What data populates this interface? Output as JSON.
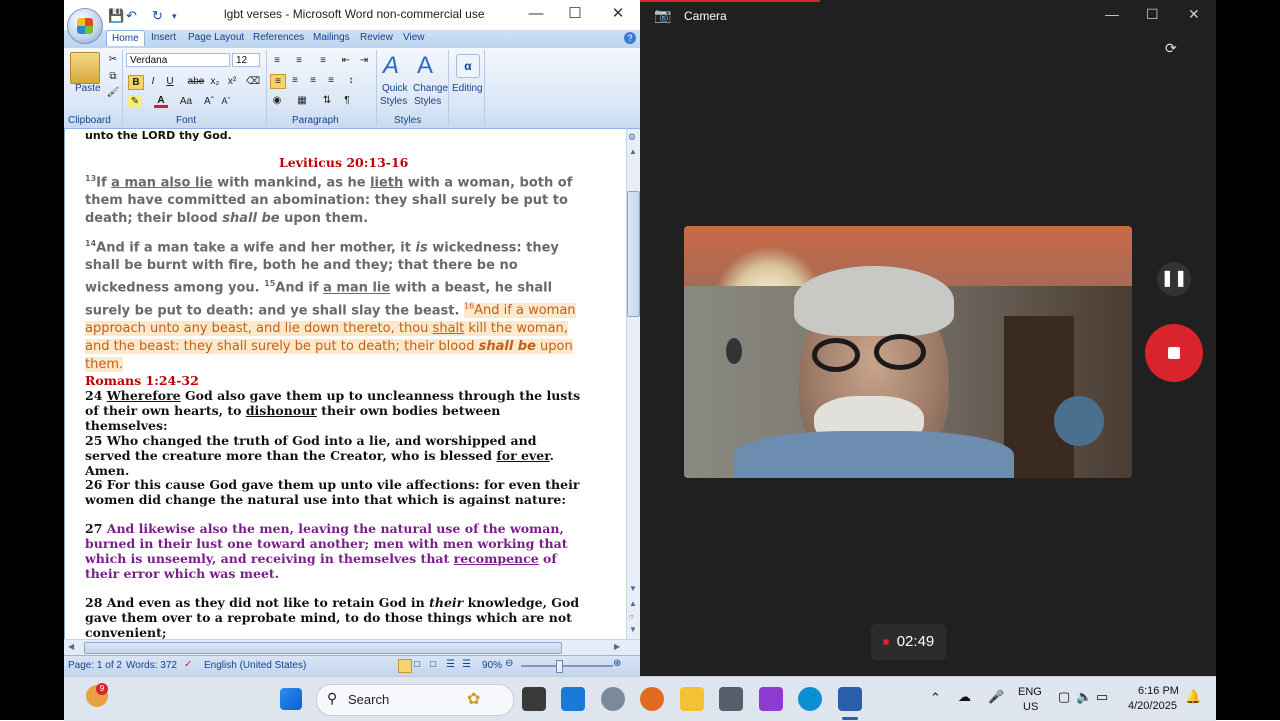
{
  "word": {
    "title": "lgbt verses - Microsoft Word non-commercial use",
    "tabs": [
      "Home",
      "Insert",
      "Page Layout",
      "References",
      "Mailings",
      "Review",
      "View"
    ],
    "ribbon": {
      "paste_label": "Paste",
      "font_name": "Verdana",
      "font_size": "12",
      "quick_styles_1": "Quick",
      "quick_styles_2": "Styles",
      "change_styles_1": "Change",
      "change_styles_2": "Styles",
      "editing_label": "Editing",
      "groups": [
        "Clipboard",
        "Font",
        "Paragraph",
        "Styles"
      ]
    },
    "document": {
      "top_line": "unto the LORD thy God.",
      "ref1": "Leviticus 20:13-16",
      "v13_num": "13",
      "v13_a": "If ",
      "v13_u1": "a man also lie",
      "v13_b": " with mankind, as he ",
      "v13_u2": "lieth",
      "v13_c": " with a woman, both of them have committed an abomination: they shall surely be put to death; their blood ",
      "v13_it": "shall be",
      "v13_d": " upon them.",
      "v14_num": "14",
      "v14_a": "And if a man take a wife and her mother, it ",
      "v14_it": "is",
      "v14_b": " wickedness: they shall be burnt with fire, both he and they; that there be no wickedness among you. ",
      "v15_num": "15",
      "v15_a": "And if ",
      "v15_u": "a man lie",
      "v15_b": " with a beast, he shall surely be put to death: and ye shall slay the beast. ",
      "v16_num": "16",
      "v16_a": "And if a woman approach unto any beast, and lie down thereto, thou ",
      "v16_u": "shalt",
      "v16_b": " kill the woman, and the beast: they shall surely be put to death; their blood ",
      "v16_it": "shall be",
      "v16_c": " upon them.",
      "ref2": "Romans 1:24-32",
      "r24_a": "24 ",
      "r24_u1": "Wherefore",
      "r24_b": " God also gave them up to uncleanness through the lusts of their own hearts, to ",
      "r24_u2": "dishonour",
      "r24_c": " their own bodies between themselves:",
      "r25_a": "25 Who changed the truth of God into a lie, and worshipped and served the creature more than the Creator, who is blessed ",
      "r25_u": "for ever",
      "r25_b": ". Amen.",
      "r26": "26 For this cause God gave them up unto vile affections: for even their women did change the natural use into that which is against nature:",
      "r27_num": "27 ",
      "r27_a": "And likewise also the men, leaving the natural use of the woman, burned in their lust one toward another; men with men working that which is unseemly, and receiving in themselves that ",
      "r27_u": "recompence",
      "r27_b": " of their error which was meet.",
      "r28_a": "28 And even as they did not like to retain God in ",
      "r28_it": "their",
      "r28_b": " knowledge, God gave them over to a reprobate mind, to do those things which are not convenient;"
    },
    "status": {
      "page": "Page: 1 of 2",
      "words": "Words: 372",
      "language": "English (United States)",
      "zoom": "90%"
    }
  },
  "camera": {
    "title": "Camera",
    "timer": "02:49",
    "pause_icon": "pause-icon",
    "stop_icon": "stop-icon"
  },
  "taskbar": {
    "badge": "9",
    "search_label": "Search",
    "lang_1": "ENG",
    "lang_2": "US",
    "time": "6:16 PM",
    "date": "4/20/2025"
  },
  "colors": {
    "accent_red": "#d9242c",
    "ribbon_blue": "#15428b",
    "ref_red": "#c00000",
    "purple": "#7a1f8a",
    "highlight": "#fde9c9"
  }
}
